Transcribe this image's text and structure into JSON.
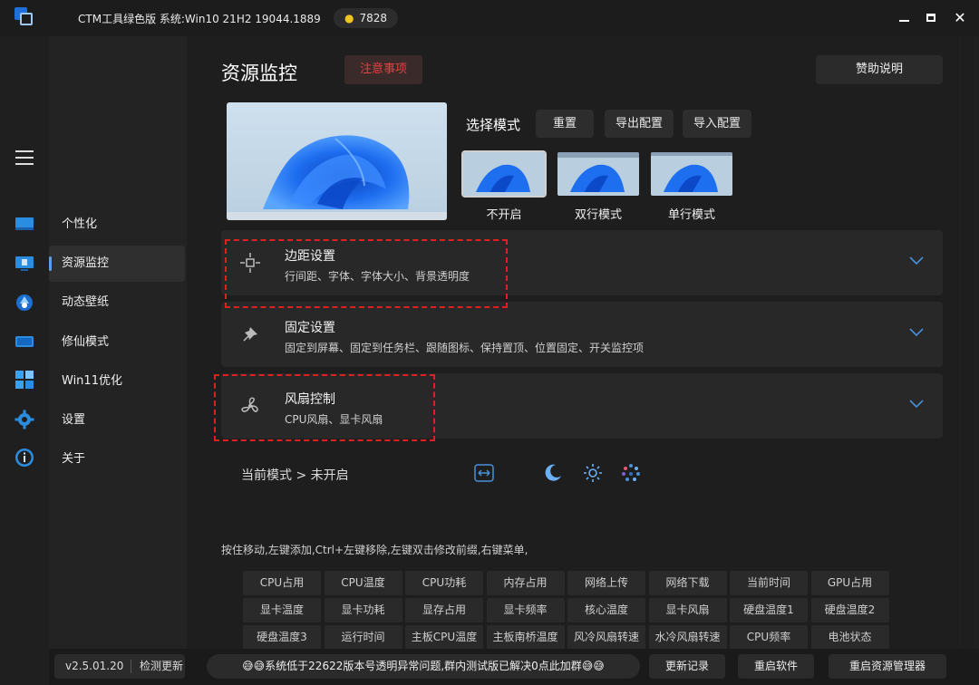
{
  "titlebar": {
    "title": "CTM工具绿色版  系统:Win10 21H2 19044.1889",
    "badge": "7828"
  },
  "nav": {
    "items": [
      {
        "label": "个性化"
      },
      {
        "label": "资源监控",
        "active": true
      },
      {
        "label": "动态壁纸"
      },
      {
        "label": "修仙模式"
      },
      {
        "label": "Win11优化"
      },
      {
        "label": "设置"
      },
      {
        "label": "关于"
      }
    ]
  },
  "main": {
    "title": "资源监控",
    "notice_button": "注意事项",
    "sponsor_button": "赞助说明",
    "mode_label": "选择模式",
    "buttons": {
      "reset": "重置",
      "export": "导出配置",
      "import": "导入配置"
    },
    "modes": [
      {
        "label": "不开启",
        "selected": true
      },
      {
        "label": "双行模式"
      },
      {
        "label": "单行模式"
      }
    ],
    "panels": [
      {
        "title": "边距设置",
        "subtitle": "行间距、字体、字体大小、背景透明度",
        "icon": "margin-icon"
      },
      {
        "title": "固定设置",
        "subtitle": "固定到屏幕、固定到任务栏、跟随图标、保持置顶、位置固定、开关监控项",
        "icon": "pin-icon"
      },
      {
        "title": "风扇控制",
        "subtitle": "CPU风扇、显卡风扇",
        "icon": "fan-icon"
      }
    ],
    "current_mode": "当前模式 > 未开启",
    "hint": "按住移动,左键添加,Ctrl+左键移除,左键双击修改前缀,右键菜单,",
    "chips": [
      [
        "CPU占用",
        "CPU温度",
        "CPU功耗",
        "内存占用",
        "网络上传",
        "网络下载",
        "当前时间",
        "GPU占用"
      ],
      [
        "显卡温度",
        "显卡功耗",
        "显存占用",
        "显卡频率",
        "核心温度",
        "显卡风扇",
        "硬盘温度1",
        "硬盘温度2"
      ],
      [
        "硬盘温度3",
        "运行时间",
        "主板CPU温度",
        "主板南桥温度",
        "风冷风扇转速",
        "水冷风扇转速",
        "CPU频率",
        "电池状态"
      ]
    ]
  },
  "bottombar": {
    "version": "v2.5.01.20",
    "check_update": "检测更新",
    "notice": "😅😅系统低于22622版本号透明异常问题,群内测试版已解决0点此加群😅😅",
    "update_log": "更新记录",
    "restart_software": "重启软件",
    "restart_explorer": "重启资源管理器"
  },
  "colors": {
    "accent": "#5ba0ea",
    "notice_red": "#e74040",
    "annotation_red": "#e02020",
    "badge_dot": "#f0c420"
  }
}
